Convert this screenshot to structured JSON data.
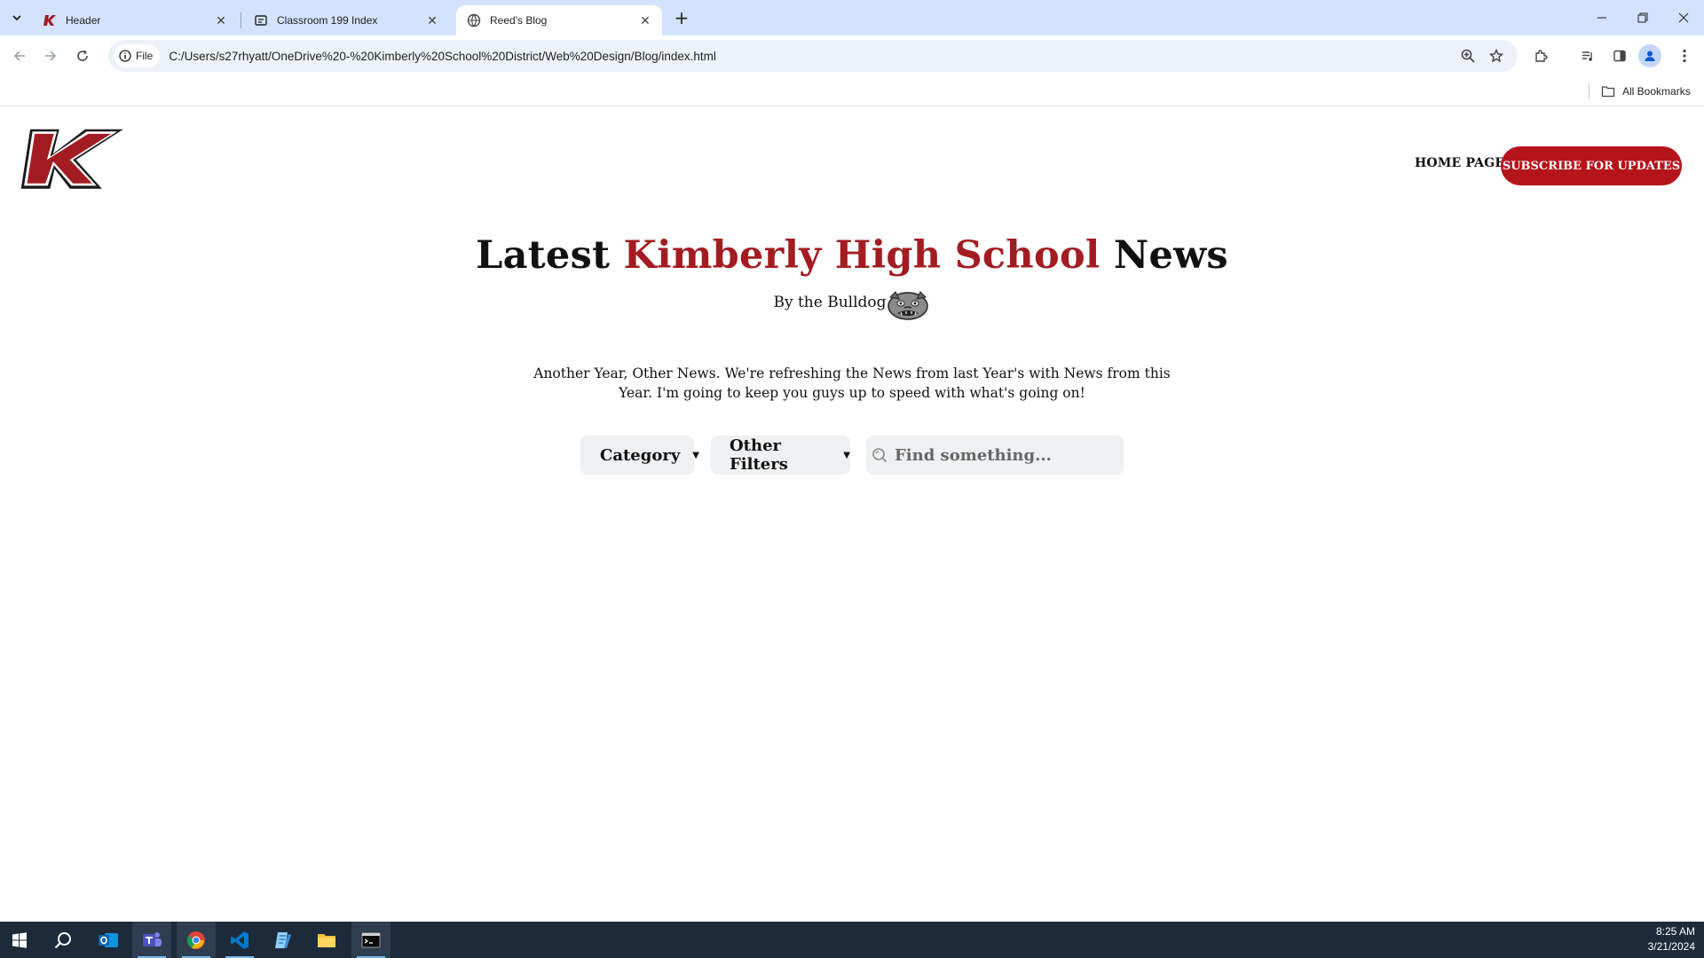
{
  "browser": {
    "tabs": [
      {
        "title": "Header",
        "favicon": "kimberly-k-icon",
        "active": false
      },
      {
        "title": "Classroom 199 Index",
        "favicon": "document-icon",
        "active": false
      },
      {
        "title": "Reed's Blog",
        "favicon": "globe-icon",
        "active": true
      }
    ],
    "chip_label": "File",
    "url": "C:/Users/s27rhyatt/OneDrive%20-%20Kimberly%20School%20District/Web%20Design/Blog/index.html",
    "bookmarks_label": "All Bookmarks"
  },
  "site": {
    "nav_home": "HOME PAGE",
    "nav_subscribe": "SUBSCRIBE FOR UPDATES",
    "headline_pre": "Latest ",
    "headline_accent": "Kimberly High School",
    "headline_post": " News",
    "byline": "By the Bulldog",
    "intro": "Another Year, Other News. We're refreshing the News from last Year's with News from this Year. I'm going to keep you guys up to speed with what's going on!",
    "filter_category": "Category",
    "filter_other": "Other Filters",
    "search_placeholder": "Find something...",
    "accent_color": "#a31c22",
    "button_color": "#b5141b"
  },
  "taskbar": {
    "apps": [
      "start-icon",
      "search-icon",
      "outlook-icon",
      "teams-icon",
      "chrome-icon",
      "vscode-icon",
      "notepad-icon",
      "file-explorer-icon",
      "terminal-icon"
    ],
    "time": "8:25 AM",
    "date": "3/21/2024"
  }
}
